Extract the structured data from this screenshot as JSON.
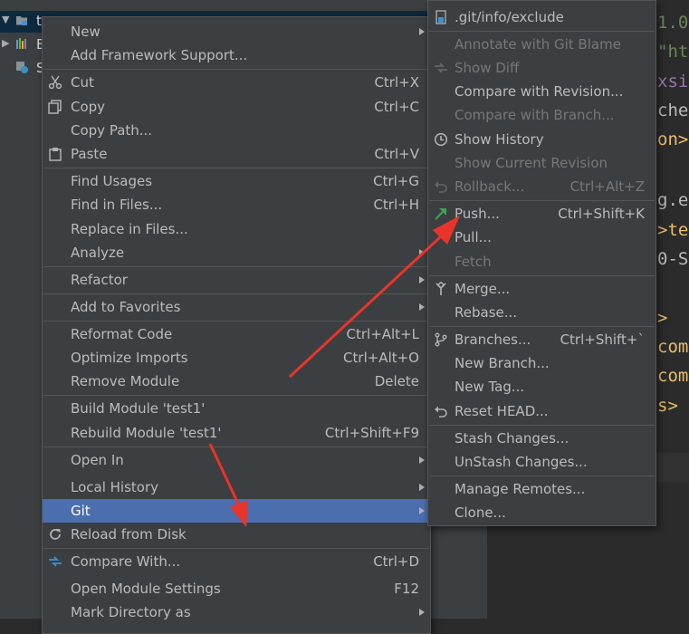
{
  "project_tree": {
    "rows": [
      {
        "label": "t"
      },
      {
        "label": "E"
      },
      {
        "label": "S"
      }
    ]
  },
  "editor": {
    "lines": [
      {
        "text": "1.0",
        "color": "#6a8759"
      },
      {
        "text": "\"ht",
        "color": "#6a8759"
      },
      {
        "text": "xsi",
        "color": "#9876aa"
      },
      {
        "text": "chem",
        "color": "#bababa"
      },
      {
        "text": "on>",
        "color": "#e8bf6a"
      },
      {
        "text": "g.e",
        "color": "#bababa"
      },
      {
        "text": ">te",
        "color": "#e8bf6a"
      },
      {
        "text": "0-S",
        "color": "#bababa"
      },
      {
        "text": ">",
        "color": "#e8bf6a"
      },
      {
        "text": "com",
        "color": "#e8bf6a"
      },
      {
        "text": "com",
        "color": "#e8bf6a"
      },
      {
        "text": "s>",
        "color": "#e8bf6a"
      }
    ]
  },
  "context_menu": {
    "items": [
      {
        "label": "New",
        "submenu": true
      },
      {
        "label": "Add Framework Support..."
      },
      {
        "label": "Cut",
        "shortcut": "Ctrl+X",
        "icon": "scissors-icon"
      },
      {
        "label": "Copy",
        "shortcut": "Ctrl+C",
        "icon": "copy-icon"
      },
      {
        "label": "Copy Path..."
      },
      {
        "label": "Paste",
        "shortcut": "Ctrl+V",
        "icon": "clipboard-icon"
      },
      {
        "label": "Find Usages",
        "shortcut": "Ctrl+G"
      },
      {
        "label": "Find in Files...",
        "shortcut": "Ctrl+H"
      },
      {
        "label": "Replace in Files..."
      },
      {
        "label": "Analyze",
        "submenu": true
      },
      {
        "label": "Refactor",
        "submenu": true
      },
      {
        "label": "Add to Favorites",
        "submenu": true
      },
      {
        "label": "Reformat Code",
        "shortcut": "Ctrl+Alt+L"
      },
      {
        "label": "Optimize Imports",
        "shortcut": "Ctrl+Alt+O"
      },
      {
        "label": "Remove Module",
        "shortcut": "Delete"
      },
      {
        "label": "Build Module 'test1'"
      },
      {
        "label": "Rebuild Module 'test1'",
        "shortcut": "Ctrl+Shift+F9"
      },
      {
        "label": "Open In",
        "submenu": true
      },
      {
        "label": "Local History",
        "submenu": true
      },
      {
        "label": "Git",
        "submenu": true,
        "highlighted": true
      },
      {
        "label": "Reload from Disk",
        "icon": "reload-icon"
      },
      {
        "label": "Compare With...",
        "shortcut": "Ctrl+D",
        "icon": "compare-arrows-icon"
      },
      {
        "label": "Open Module Settings",
        "shortcut": "F12"
      },
      {
        "label": "Mark Directory as",
        "submenu": true
      }
    ]
  },
  "git_menu": {
    "items": [
      {
        "label": ".git/info/exclude",
        "icon": "git-file-icon"
      },
      {
        "label": "Annotate with Git Blame",
        "disabled": true
      },
      {
        "label": "Show Diff",
        "disabled": true,
        "icon": "diff-icon"
      },
      {
        "label": "Compare with Revision..."
      },
      {
        "label": "Compare with Branch...",
        "disabled": true
      },
      {
        "label": "Show History",
        "icon": "clock-icon"
      },
      {
        "label": "Show Current Revision",
        "disabled": true
      },
      {
        "label": "Rollback...",
        "shortcut": "Ctrl+Alt+Z",
        "disabled": true,
        "icon": "undo-icon"
      },
      {
        "label": "Push...",
        "shortcut": "Ctrl+Shift+K",
        "icon": "push-arrow-icon"
      },
      {
        "label": "Pull..."
      },
      {
        "label": "Fetch",
        "disabled": true
      },
      {
        "label": "Merge...",
        "icon": "merge-icon"
      },
      {
        "label": "Rebase..."
      },
      {
        "label": "Branches...",
        "shortcut": "Ctrl+Shift+`",
        "icon": "branch-icon"
      },
      {
        "label": "New Branch..."
      },
      {
        "label": "New Tag..."
      },
      {
        "label": "Reset HEAD...",
        "icon": "reset-icon"
      },
      {
        "label": "Stash Changes..."
      },
      {
        "label": "UnStash Changes..."
      },
      {
        "label": "Manage Remotes..."
      },
      {
        "label": "Clone..."
      }
    ]
  },
  "colors": {
    "menu_bg": "#3c3f41",
    "highlight": "#4b6eaf",
    "annotation_arrow": "#e8342a",
    "push_icon": "#3fa34d"
  }
}
